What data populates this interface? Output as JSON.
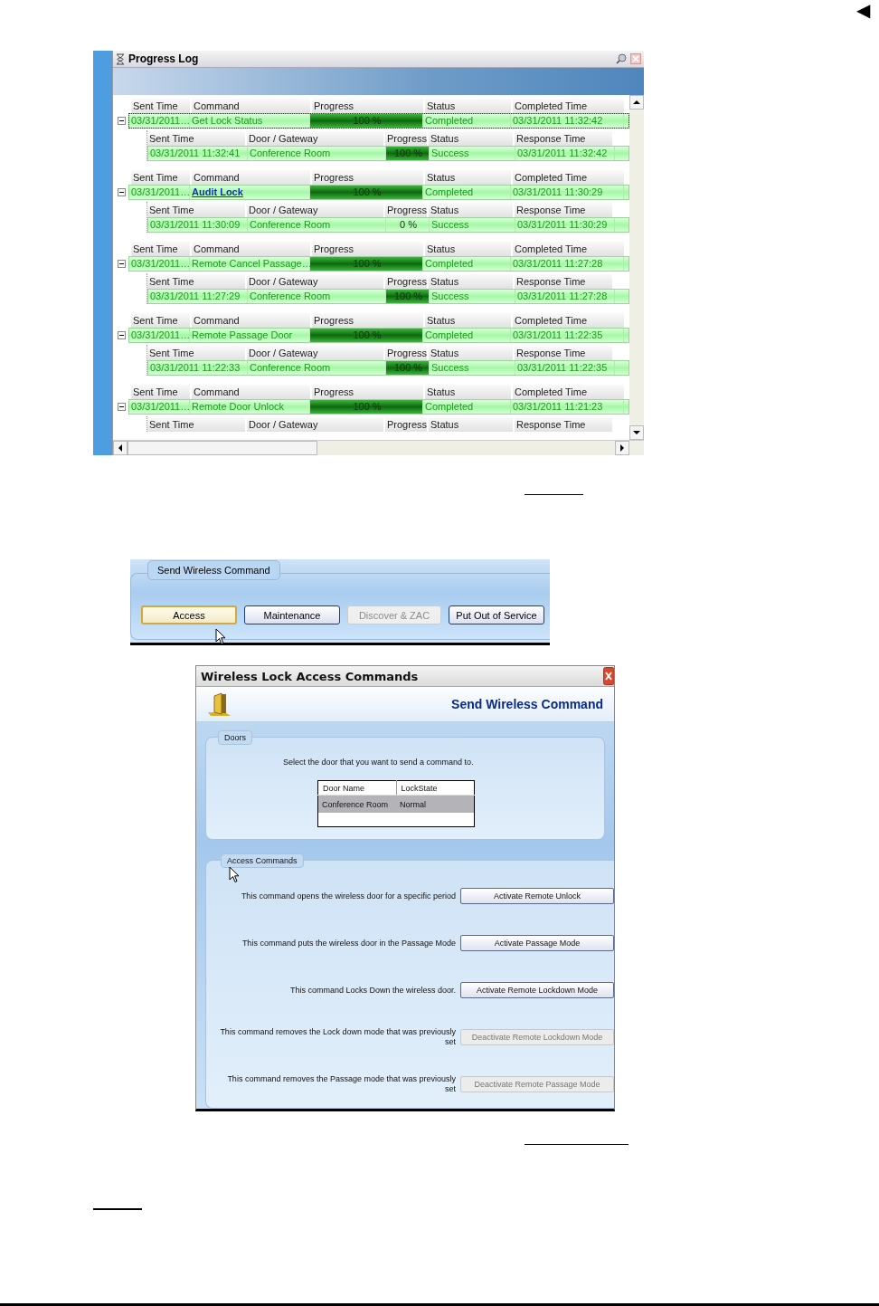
{
  "nav_marker": "◀",
  "progress_log": {
    "title": "Progress Log",
    "groups": [
      {
        "selected": true,
        "expanded": true,
        "columns": [
          "Sent Time",
          "Command",
          "Progress",
          "Status",
          "Completed Time"
        ],
        "sent_time": "03/31/2011…",
        "command": "Get Lock Status",
        "kind": "text",
        "level": 1,
        "progress": "100 %",
        "status": "Completed",
        "completed_time": "03/31/2011 11:32:42",
        "child": {
          "columns": [
            "Sent Time",
            "Door / Gateway",
            "Progress",
            "Status",
            "Response Time"
          ],
          "row": {
            "sent_time": "03/31/2011 11:32:41",
            "door": "Conference Room",
            "level": 1,
            "progress": "100 %",
            "status": "Success",
            "response_time": "03/31/2011 11:32:42"
          }
        }
      },
      {
        "selected": false,
        "expanded": true,
        "columns": [
          "Sent Time",
          "Command",
          "Progress",
          "Status",
          "Completed Time"
        ],
        "sent_time": "03/31/2011…",
        "command": "Audit Lock",
        "kind": "link",
        "level": 1,
        "progress": "100 %",
        "status": "Completed",
        "completed_time": "03/31/2011 11:30:29",
        "child": {
          "columns": [
            "Sent Time",
            "Door / Gateway",
            "Progress",
            "Status",
            "Response Time"
          ],
          "row": {
            "sent_time": "03/31/2011 11:30:09",
            "door": "Conference Room",
            "progress": "0 %",
            "status": "Success",
            "response_time": "03/31/2011 11:30:29"
          }
        }
      },
      {
        "selected": false,
        "expanded": true,
        "columns": [
          "Sent Time",
          "Command",
          "Progress",
          "Status",
          "Completed Time"
        ],
        "sent_time": "03/31/2011…",
        "command": "Remote  Cancel  Passage…",
        "kind": "text",
        "level": 1,
        "progress": "100 %",
        "status": "Completed",
        "completed_time": "03/31/2011 11:27:28",
        "child": {
          "columns": [
            "Sent Time",
            "Door / Gateway",
            "Progress",
            "Status",
            "Response Time"
          ],
          "row": {
            "sent_time": "03/31/2011 11:27:29",
            "door": "Conference Room",
            "level": 1,
            "progress": "100 %",
            "status": "Success",
            "response_time": "03/31/2011 11:27:28"
          }
        }
      },
      {
        "selected": false,
        "expanded": true,
        "columns": [
          "Sent Time",
          "Command",
          "Progress",
          "Status",
          "Completed Time"
        ],
        "sent_time": "03/31/2011…",
        "command": "Remote Passage Door",
        "kind": "text",
        "level": 1,
        "progress": "100 %",
        "status": "Completed",
        "completed_time": "03/31/2011 11:22:35",
        "child": {
          "columns": [
            "Sent Time",
            "Door / Gateway",
            "Progress",
            "Status",
            "Response Time"
          ],
          "row": {
            "sent_time": "03/31/2011 11:22:33",
            "door": "Conference Room",
            "level": 1,
            "progress": "100 %",
            "status": "Success",
            "response_time": "03/31/2011 11:22:35"
          }
        }
      },
      {
        "selected": false,
        "expanded": true,
        "columns": [
          "Sent Time",
          "Command",
          "Progress",
          "Status",
          "Completed Time"
        ],
        "sent_time": "03/31/2011…",
        "command": "Remote Door Unlock",
        "kind": "text",
        "level": 1,
        "progress": "100 %",
        "status": "Completed",
        "completed_time": "03/31/2011 11:21:23",
        "child": {
          "columns": [
            "Sent Time",
            "Door / Gateway",
            "Progress",
            "Status",
            "Response Time"
          ]
        }
      }
    ]
  },
  "command_bar": {
    "group_title": "Send Wireless Command",
    "buttons": [
      {
        "label": "Access",
        "selected": true,
        "disabled": false
      },
      {
        "label": "Maintenance",
        "selected": false,
        "disabled": false
      },
      {
        "label": "Discover & ZAC",
        "selected": false,
        "disabled": true
      },
      {
        "label": "Put Out of Service",
        "selected": false,
        "disabled": false
      }
    ]
  },
  "dialog": {
    "title": "Wireless Lock Access Commands",
    "heading": "Send Wireless Command",
    "doors": {
      "group_title": "Doors",
      "instruction": "Select the door that you want to send a command to.",
      "columns": [
        "Door Name",
        "LockState"
      ],
      "rows": [
        {
          "cells": [
            "Conference Room",
            "Normal"
          ],
          "selected": true
        }
      ]
    },
    "access": {
      "group_title": "Access Commands",
      "commands": [
        {
          "description": "This command opens the wireless door for a specific period",
          "button": "Activate Remote Unlock",
          "disabled": false
        },
        {
          "description": "This command puts the wireless door in the Passage Mode",
          "button": "Activate Passage Mode",
          "disabled": false
        },
        {
          "description": "This command Locks Down the wireless door.",
          "button": "Activate Remote Lockdown Mode",
          "disabled": false
        },
        {
          "description": "This command removes the Lock down mode that was previously set",
          "button": "Deactivate Remote Lockdown Mode",
          "disabled": true
        },
        {
          "description": "This command removes the Passage mode that was previously set",
          "button": "Deactivate Remote Passage Mode",
          "disabled": true
        }
      ]
    }
  }
}
